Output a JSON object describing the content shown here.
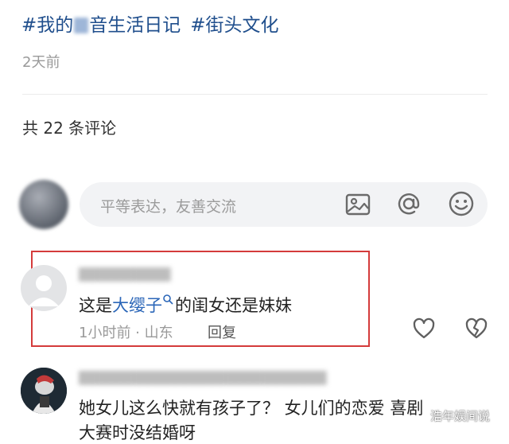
{
  "post": {
    "hashtag1_prefix": "#我的",
    "hashtag1_suffix": "音生活日记",
    "hashtag2": "#街头文化",
    "time_ago": "2天前",
    "comment_count": "共 22 条评论"
  },
  "composer": {
    "placeholder": "平等表达，友善交流",
    "image_icon": "image-icon",
    "mention_icon": "at-icon",
    "emoji_icon": "emoji-icon"
  },
  "comments": [
    {
      "text_prefix": "这是",
      "link_text": "大缨子",
      "text_suffix": "的闺女还是妹妹",
      "meta": "1小时前 · 山东",
      "reply_label": "回复",
      "highlighted": true,
      "highlight_color": "#d43b3b"
    },
    {
      "text_line1": "她女儿这么快就有孩子了？ 女儿们的恋爱 喜剧",
      "text_line2": "大赛时没结婚呀"
    }
  ],
  "watermark": "浩年娱间说",
  "colors": {
    "link": "#2b66b8",
    "hashtag": "#1f4e8c"
  }
}
